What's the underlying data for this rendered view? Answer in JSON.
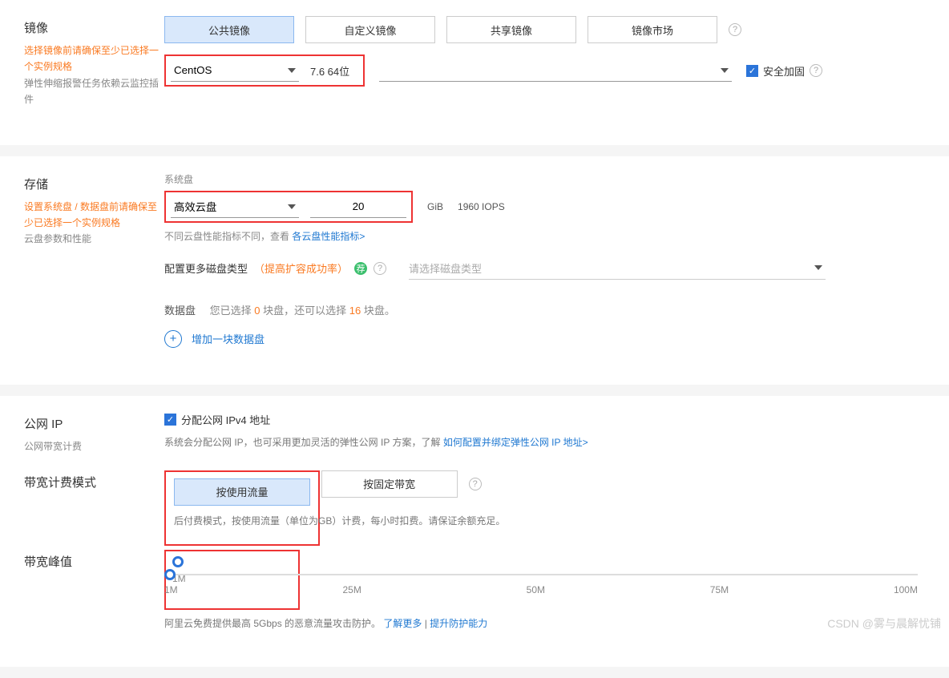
{
  "image": {
    "title": "镜像",
    "warn": "选择镜像前请确保至少已选择一个实例规格",
    "hint": "弹性伸缩报警任务依赖云监控插件",
    "tabs": [
      "公共镜像",
      "自定义镜像",
      "共享镜像",
      "镜像市场"
    ],
    "os": "CentOS",
    "ver": "7.6 64位",
    "secure": "安全加固"
  },
  "storage": {
    "title": "存储",
    "warn": "设置系统盘 / 数据盘前请确保至少已选择一个实例规格",
    "hint": "云盘参数和性能",
    "sysdisk_label": "系统盘",
    "sysdisk_type": "高效云盘",
    "sysdisk_size": "20",
    "sysdisk_unit": "GiB",
    "sysdisk_iops": "1960 IOPS",
    "perf_text1": "不同云盘性能指标不同，查看 ",
    "perf_link": "各云盘性能指标>",
    "more_disk": "配置更多磁盘类型",
    "more_disk_tip": "（提高扩容成功率）",
    "badge": "荐",
    "disk_type_ph": "请选择磁盘类型",
    "data_label": "数据盘",
    "data_text1": "您已选择 ",
    "data_n1": "0",
    "data_text2": " 块盘，还可以选择 ",
    "data_n2": "16",
    "data_text3": " 块盘。",
    "add_disk": "增加一块数据盘"
  },
  "ip": {
    "title": "公网 IP",
    "sub": "公网带宽计费",
    "assign": "分配公网 IPv4 地址",
    "desc1": "系统会分配公网 IP，也可采用更加灵活的弹性公网 IP 方案，了解 ",
    "desc_link": "如何配置并绑定弹性公网 IP 地址>"
  },
  "bw_mode": {
    "title": "带宽计费模式",
    "tabs": [
      "按使用流量",
      "按固定带宽"
    ],
    "info": "后付费模式，按使用流量（单位为GB）计费，每小时扣费。请保证余额充足。"
  },
  "peak": {
    "title": "带宽峰值",
    "ticks": [
      "1M",
      "25M",
      "50M",
      "75M",
      "100M"
    ],
    "foot1": "阿里云免费提供最高 5Gbps 的恶意流量攻击防护。",
    "foot_link1": "了解更多",
    "foot_sep": " | ",
    "foot_link2": "提升防护能力"
  },
  "wm": "CSDN @雾与晨解忧铺"
}
